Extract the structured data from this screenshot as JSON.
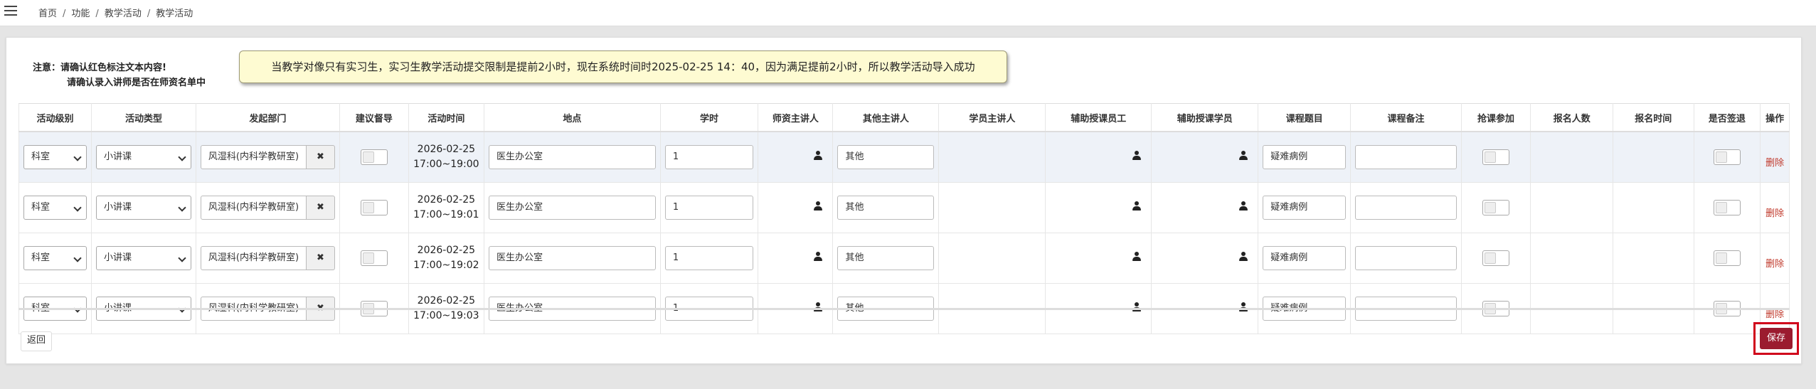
{
  "breadcrumb": [
    "首页",
    "功能",
    "教学活动",
    "教学活动"
  ],
  "notice": {
    "line1": "注意：请确认红色标注文本内容!",
    "line2": "请确认录入讲师是否在师资名单中"
  },
  "tooltip": "当教学对像只有实习生，实习生教学活动提交限制是提前2小时，现在系统时间时2025-02-25 14：40，因为满足提前2小时，所以教学活动导入成功",
  "table": {
    "headers": [
      "活动级别",
      "活动类型",
      "发起部门",
      "建议督导",
      "活动时间",
      "地点",
      "学时",
      "师资主讲人",
      "其他主讲人",
      "学员主讲人",
      "辅助授课员工",
      "辅助授课学员",
      "课程题目",
      "课程备注",
      "抢课参加",
      "报名人数",
      "报名时间",
      "是否签退",
      "操作"
    ],
    "rows": [
      {
        "level": "科室",
        "type": "小讲课",
        "dept": "风湿科(内科学教研室)",
        "date": "2026-02-25",
        "time": "17:00~19:00",
        "place": "医生办公室",
        "hours": "1",
        "other": "其他",
        "topic": "疑难病例",
        "remark": "",
        "action": "删除"
      },
      {
        "level": "科室",
        "type": "小讲课",
        "dept": "风湿科(内科学教研室)",
        "date": "2026-02-25",
        "time": "17:00~19:01",
        "place": "医生办公室",
        "hours": "1",
        "other": "其他",
        "topic": "疑难病例",
        "remark": "",
        "action": "删除"
      },
      {
        "level": "科室",
        "type": "小讲课",
        "dept": "风湿科(内科学教研室)",
        "date": "2026-02-25",
        "time": "17:00~19:02",
        "place": "医生办公室",
        "hours": "1",
        "other": "其他",
        "topic": "疑难病例",
        "remark": "",
        "action": "删除"
      },
      {
        "level": "科室",
        "type": "小讲课",
        "dept": "风湿科(内科学教研室)",
        "date": "2026-02-25",
        "time": "17:00~19:03",
        "place": "医生办公室",
        "hours": "1",
        "other": "其他",
        "topic": "疑难病例",
        "remark": "",
        "action": "删除"
      }
    ]
  },
  "buttons": {
    "back": "返回",
    "save": "保存",
    "clear": "✖"
  },
  "icons": {
    "menu": "hamburger-menu-icon",
    "user": "user-icon"
  }
}
